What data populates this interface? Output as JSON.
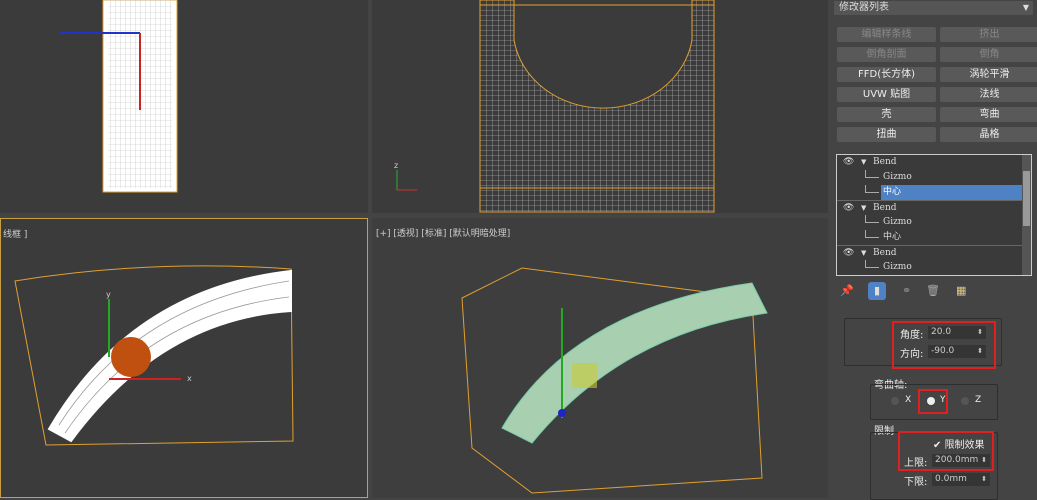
{
  "viewports": {
    "bottom_left_label": "线框 ]",
    "bottom_right_label": "[+] [透视] [标准] [默认明暗处理]"
  },
  "axis_labels": {
    "x": "x",
    "y": "y",
    "z": "z"
  },
  "panel": {
    "modifier_list": "修改器列表",
    "buttons": [
      {
        "label": "编辑样条线",
        "enabled": false
      },
      {
        "label": "挤出",
        "enabled": false
      },
      {
        "label": "倒角剖面",
        "enabled": false
      },
      {
        "label": "倒角",
        "enabled": false
      },
      {
        "label": "FFD(长方体)",
        "enabled": true
      },
      {
        "label": "涡轮平滑",
        "enabled": true
      },
      {
        "label": "UVW 贴图",
        "enabled": true
      },
      {
        "label": "法线",
        "enabled": true
      },
      {
        "label": "壳",
        "enabled": true
      },
      {
        "label": "弯曲",
        "enabled": true
      },
      {
        "label": "扭曲",
        "enabled": true
      },
      {
        "label": "晶格",
        "enabled": true
      }
    ],
    "stack": [
      {
        "type": "modifier",
        "label": "Bend"
      },
      {
        "type": "sub",
        "label": "Gizmo"
      },
      {
        "type": "sub",
        "label": "中心",
        "selected": true
      },
      {
        "type": "modifier",
        "label": "Bend"
      },
      {
        "type": "sub",
        "label": "Gizmo"
      },
      {
        "type": "sub",
        "label": "中心"
      },
      {
        "type": "modifier",
        "label": "Bend"
      },
      {
        "type": "sub",
        "label": "Gizmo"
      }
    ],
    "params": {
      "angle_label": "角度:",
      "angle_value": "20.0",
      "direction_label": "方向:",
      "direction_value": "-90.0",
      "bend_axis_label": "弯曲轴:",
      "axes": [
        "X",
        "Y",
        "Z"
      ],
      "selected_axis": "Y",
      "limits_label": "限制",
      "limit_effect_label": "限制效果",
      "limit_effect_checked": true,
      "upper_label": "上限:",
      "upper_value": "200.0mm",
      "lower_label": "下限:",
      "lower_value": "0.0mm"
    },
    "selection_color": "#4e82c4",
    "highlight_color": "#e02020"
  }
}
